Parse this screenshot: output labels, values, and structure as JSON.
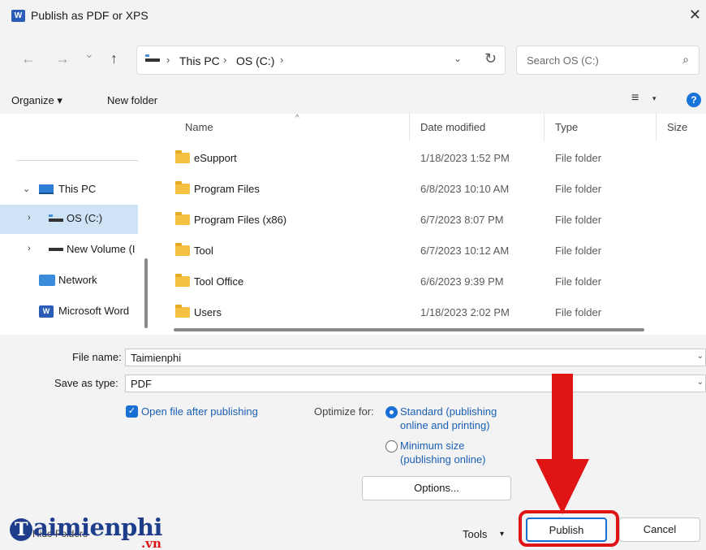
{
  "window": {
    "title": "Publish as PDF or XPS",
    "app_icon": "W",
    "close": "✕"
  },
  "nav": {
    "back": "←",
    "forward": "→",
    "recent": "⌄",
    "up": "↑",
    "breadcrumb": [
      "This PC",
      "OS (C:)"
    ],
    "sep": "›",
    "refresh": "↻",
    "dropdown": "⌄",
    "search_placeholder": "Search OS (C:)",
    "search_glyph": "⌕"
  },
  "toolbar": {
    "organize": "Organize ▾",
    "new_folder": "New folder",
    "view": "≡",
    "view_chev": "▾",
    "help": "?"
  },
  "sidebar": {
    "items": [
      {
        "label": "This PC",
        "chev": "⌄"
      },
      {
        "label": "OS (C:)",
        "chev": "›"
      },
      {
        "label": "New Volume (I",
        "chev": "›"
      },
      {
        "label": "Network"
      },
      {
        "label": "Microsoft Word",
        "icon_text": "W"
      }
    ]
  },
  "columns": {
    "name": "Name",
    "date": "Date modified",
    "type": "Type",
    "size": "Size",
    "sort": "^"
  },
  "files": [
    {
      "name": "eSupport",
      "date": "1/18/2023 1:52 PM",
      "type": "File folder"
    },
    {
      "name": "Program Files",
      "date": "6/8/2023 10:10 AM",
      "type": "File folder"
    },
    {
      "name": "Program Files (x86)",
      "date": "6/7/2023 8:07 PM",
      "type": "File folder"
    },
    {
      "name": "Tool",
      "date": "6/7/2023 10:12 AM",
      "type": "File folder"
    },
    {
      "name": "Tool Office",
      "date": "6/6/2023 9:39 PM",
      "type": "File folder"
    },
    {
      "name": "Users",
      "date": "1/18/2023 2:02 PM",
      "type": "File folder"
    }
  ],
  "form": {
    "filename_label": "File name:",
    "filename_value": "Taimienphi",
    "type_label": "Save as type:",
    "type_value": "PDF",
    "chev": "⌄"
  },
  "options": {
    "open_after": "Open file after publishing",
    "check": "✓",
    "optimize_label": "Optimize for:",
    "standard_l1": "Standard (publishing",
    "standard_l2": "online and printing)",
    "minimum_l1": "Minimum size",
    "minimum_l2": "(publishing online)",
    "options_button": "Options..."
  },
  "footer": {
    "hide_folders": "Hide Folders",
    "tools": "Tools",
    "tools_chev": "▾",
    "publish": "Publish",
    "cancel": "Cancel"
  },
  "watermark": {
    "brand_initial": "T",
    "brand_rest": "aimienphi",
    "domain": ".vn"
  },
  "colors": {
    "accent": "#1a6fd4",
    "highlight": "#e01414",
    "selected_nav": "#cfe3f6",
    "folder": "#f5c142"
  }
}
